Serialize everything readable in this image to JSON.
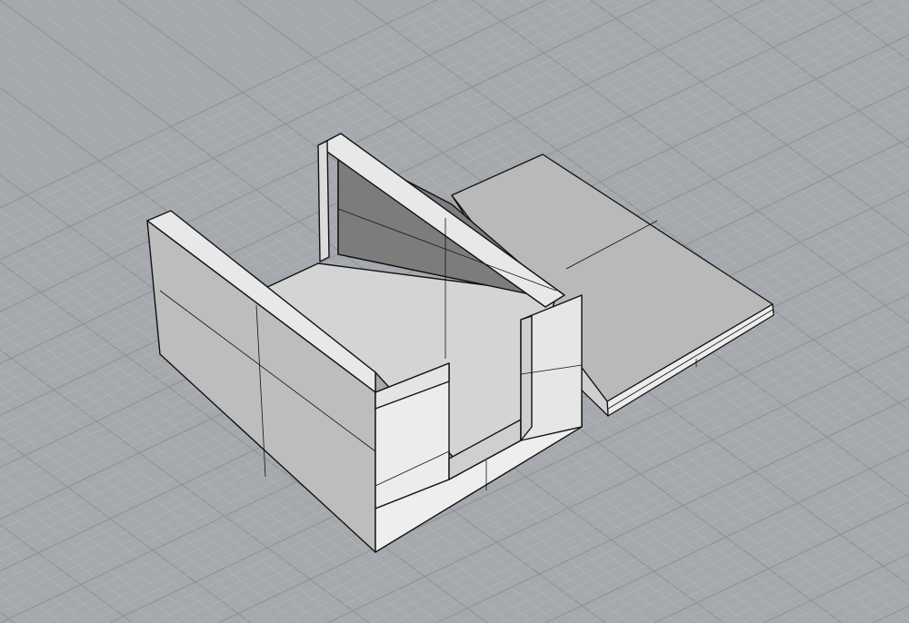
{
  "viewport": {
    "view": "perspective",
    "display_mode": "shaded",
    "grid_visible": true
  },
  "scene": {
    "objects": [
      {
        "kind": "open-box-body"
      },
      {
        "kind": "lid-plate"
      }
    ]
  },
  "colors": {
    "background": "#a5a9ae",
    "grid_minor": "#b2b6bb",
    "grid_major": "#8f9398",
    "face_light": "#e6e6e6",
    "face_mid": "#b6b6b6",
    "face_dark": "#7a7a7a",
    "edge": "#111111"
  }
}
